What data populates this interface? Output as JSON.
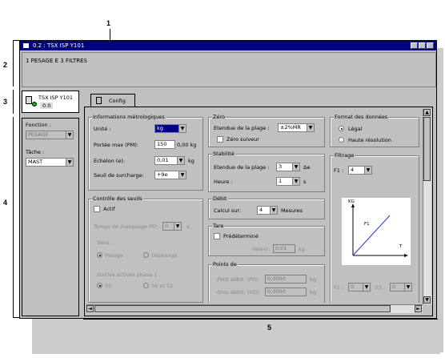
{
  "window": {
    "title": "0.2 : TSX ISP Y101",
    "description": "1 PESAGE E 3 FILTRES"
  },
  "module": {
    "name": "TSX ISP Y101",
    "address": "0.0"
  },
  "tab": {
    "label": "Config"
  },
  "left_panel": {
    "function_label": "Fonction :",
    "function_value": "PESAGE",
    "task_label": "Tâche :",
    "task_value": "MAST"
  },
  "metro": {
    "title": "Informations métrologiques",
    "unit_label": "Unité :",
    "unit_value": "kg",
    "range_label": "Portée max (PM):",
    "range_value": "150",
    "range_suffix": "0,00 kg",
    "step_label": "Echelon (e):",
    "step_value": "0,01",
    "step_unit": "kg",
    "overload_label": "Seuil de surcharge:",
    "overload_value": "+9e"
  },
  "thresholds": {
    "title": "Contrôle des seuils",
    "active_label": "Actif",
    "mask_time_label": "Temps de masquage PD:",
    "mask_time_value": "0",
    "mask_time_unit": "s",
    "direction_label": "Sens :",
    "weighing_label": "Pesage",
    "unweighing_label": "Dépesage",
    "outputs_label": "Sorties actives phase 1 :",
    "s0_label": "S0",
    "s0s1_label": "S0 et S1"
  },
  "zero": {
    "title": "Zéro",
    "range_label": "Etendue de la plage :",
    "range_value": "±2%MR",
    "follower_label": "Zéro suiveur"
  },
  "stability": {
    "title": "Stabilité",
    "range_label": "Etendue de la plage :",
    "range_value": "3",
    "range_unit": "Δe",
    "time_label": "Heure :",
    "time_value": "1",
    "time_unit": "s"
  },
  "rate": {
    "title": "Débit",
    "calc_label": "Calcul sur:",
    "calc_value": "4",
    "calc_unit": "Mesures"
  },
  "tare": {
    "title": "Tare",
    "preset_label": "Prédéterminé",
    "value_label": "Valeur:",
    "value_value": "0,01",
    "value_unit": "kg"
  },
  "points": {
    "title": "Points de",
    "small_label": "Petit débit: (PD)",
    "small_value": "0,0000",
    "small_unit": "kg",
    "large_label": "Gros débit: (GD)",
    "large_value": "0,0000",
    "large_unit": "kg"
  },
  "format": {
    "title": "Format des données",
    "legal_label": "Légal",
    "highres_label": "Haute résolution"
  },
  "filter": {
    "title": "Filtrage",
    "f1_label": "F1 :",
    "f1_value": "4",
    "chart_y_label": "KG",
    "chart_line_label": "F1",
    "chart_x_label": "T",
    "f2_label": "F2 :",
    "f2_value": "0",
    "f3_label": "F3 :",
    "f3_value": "0"
  },
  "callouts": {
    "c1": "1",
    "c2": "2",
    "c3": "3",
    "c4": "4",
    "c5": "5"
  }
}
